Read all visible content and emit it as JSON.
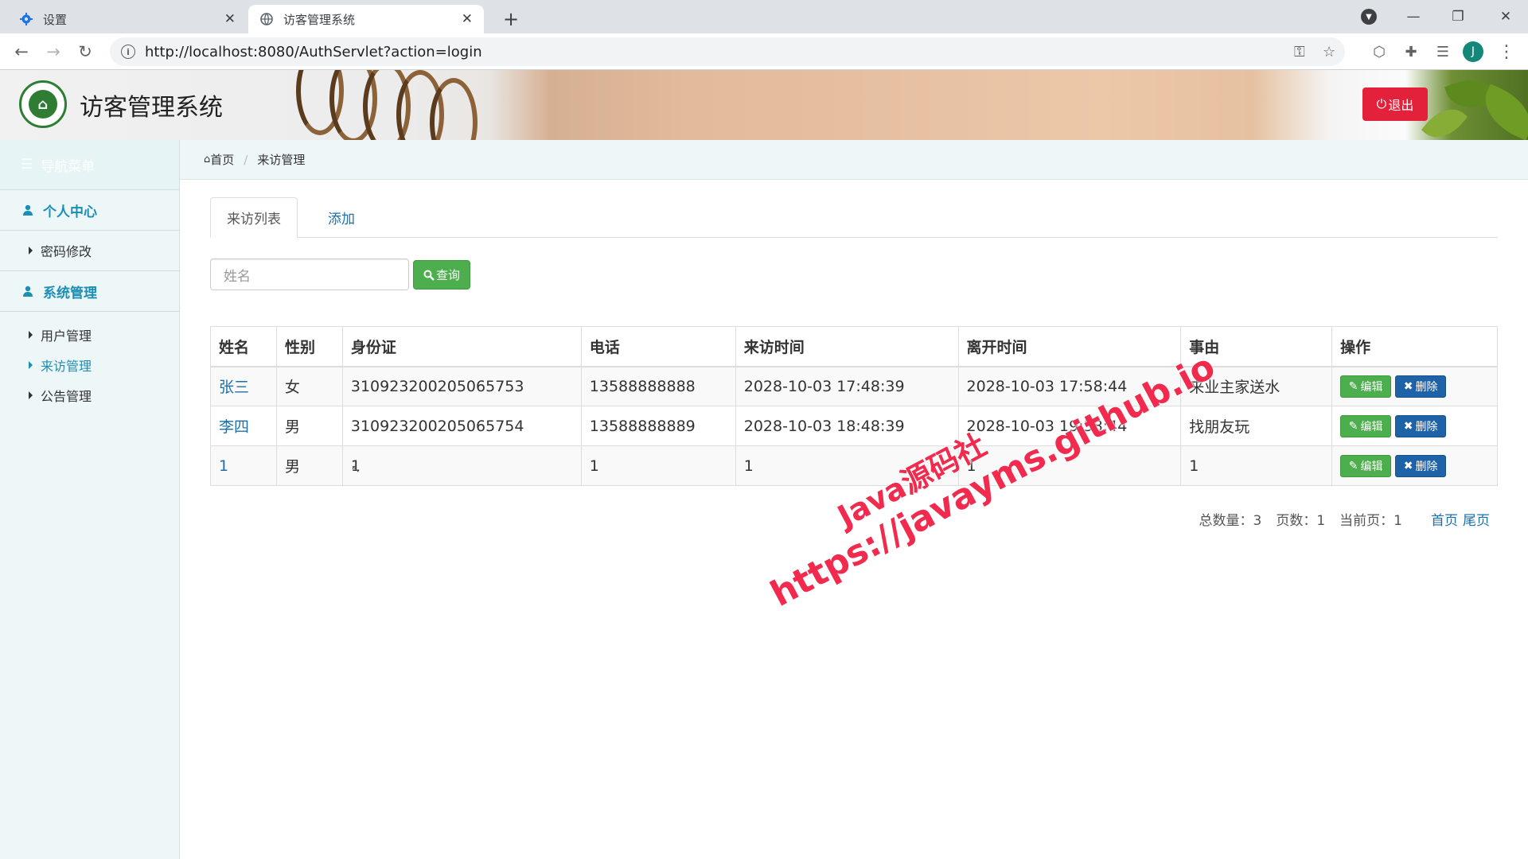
{
  "browser": {
    "tabs": [
      {
        "label": "设置",
        "icon": "gear-icon"
      },
      {
        "label": "访客管理系统",
        "icon": "globe-icon"
      }
    ],
    "url": "http://localhost:8080/AuthServlet?action=login",
    "profile_initial": "J"
  },
  "header": {
    "title": "访客管理系统",
    "logout_label": "退出"
  },
  "sidebar": {
    "head_label": "导航菜单",
    "sections": [
      {
        "label": "个人中心",
        "items": [
          {
            "label": "密码修改"
          }
        ]
      },
      {
        "label": "系统管理",
        "items": [
          {
            "label": "用户管理"
          },
          {
            "label": "来访管理"
          },
          {
            "label": "公告管理"
          }
        ]
      }
    ]
  },
  "breadcrumb": {
    "home": "首页",
    "current": "来访管理"
  },
  "tabs": {
    "list": "来访列表",
    "add": "添加"
  },
  "search": {
    "placeholder": "姓名",
    "button": "查询"
  },
  "table": {
    "headers": [
      "姓名",
      "性别",
      "身份证",
      "电话",
      "来访时间",
      "离开时间",
      "事由",
      "操作"
    ],
    "rows": [
      {
        "name": "张三",
        "gender": "女",
        "id_card": "310923200205065753",
        "phone": "13588888888",
        "visit_time": "2028-10-03 17:48:39",
        "leave_time": "2028-10-03 17:58:44",
        "reason": "来业主家送水"
      },
      {
        "name": "李四",
        "gender": "男",
        "id_card": "310923200205065754",
        "phone": "13588888889",
        "visit_time": "2028-10-03 18:48:39",
        "leave_time": "2028-10-03 19:58:44",
        "reason": "找朋友玩"
      },
      {
        "name": "1",
        "gender": "男",
        "id_card": "1",
        "phone": "1",
        "visit_time": "1",
        "leave_time": "1",
        "reason": "1"
      }
    ],
    "edit_label": "编辑",
    "delete_label": "删除"
  },
  "pager": {
    "total": "总数量：3",
    "pages": "页数：1",
    "current": "当前页：1",
    "first": "首页",
    "last": "尾页"
  },
  "watermark": {
    "line1": "Java源码社",
    "line2": "https://javayms.github.io"
  }
}
